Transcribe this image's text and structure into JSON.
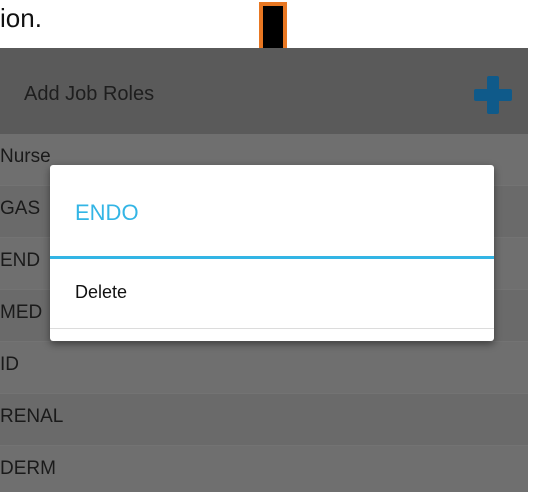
{
  "caption": {
    "text": "ion."
  },
  "appbar": {
    "title": "Add Job Roles",
    "add_icon": "plus-icon",
    "add_icon_color": "#0f5a8a"
  },
  "list": {
    "items": [
      {
        "label": "Nurse"
      },
      {
        "label": "GAS"
      },
      {
        "label": "END"
      },
      {
        "label": "MED"
      },
      {
        "label": "ID"
      },
      {
        "label": "RENAL"
      },
      {
        "label": "DERM"
      }
    ]
  },
  "dialog": {
    "title": "ENDO",
    "title_color": "#33b5e5",
    "items": [
      {
        "label": "Delete"
      }
    ]
  },
  "annotation": {
    "arrow_icon": "arrow-down-icon",
    "arrow_fill": "#000000",
    "arrow_outline": "#e87722"
  }
}
